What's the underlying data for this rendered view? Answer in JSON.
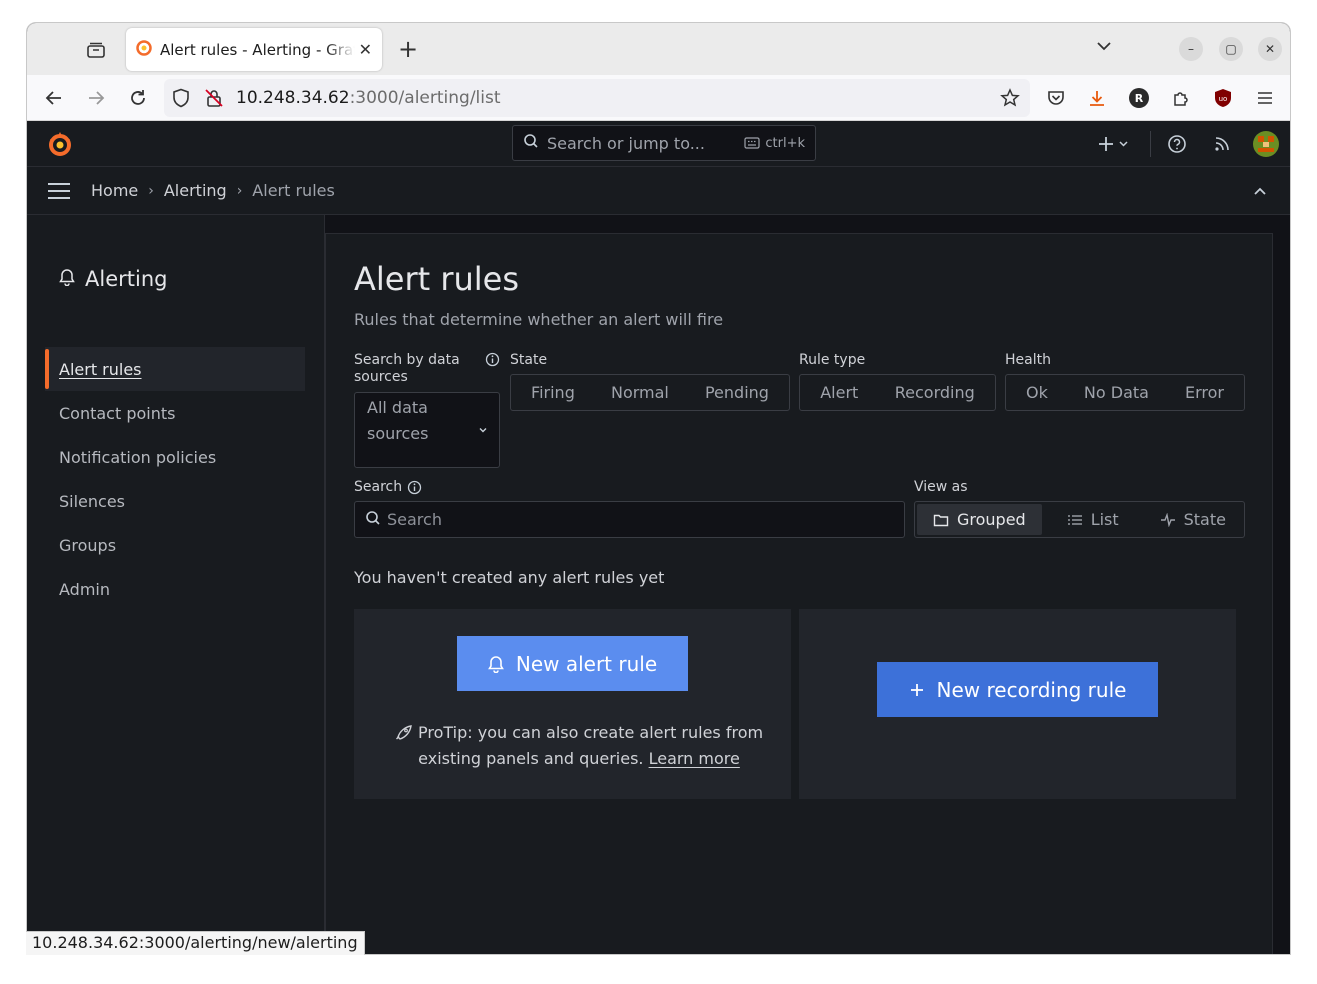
{
  "browser": {
    "tab_title": "Alert rules - Alerting - Grafana",
    "url_host": "10.248.34.62",
    "url_path": ":3000/alerting/list",
    "status_url": "10.248.34.62:3000/alerting/new/alerting",
    "profile_initial": "R"
  },
  "topbar": {
    "search_placeholder": "Search or jump to...",
    "shortcut": "ctrl+k"
  },
  "breadcrumb": {
    "home": "Home",
    "alerting": "Alerting",
    "current": "Alert rules"
  },
  "sidebar": {
    "heading": "Alerting",
    "items": [
      {
        "label": "Alert rules"
      },
      {
        "label": "Contact points"
      },
      {
        "label": "Notification policies"
      },
      {
        "label": "Silences"
      },
      {
        "label": "Groups"
      },
      {
        "label": "Admin"
      }
    ]
  },
  "page": {
    "title": "Alert rules",
    "subtitle": "Rules that determine whether an alert will fire"
  },
  "filters": {
    "datasource_label": "Search by data sources",
    "datasource_value": "All data sources",
    "state_label": "State",
    "state_options": [
      "Firing",
      "Normal",
      "Pending"
    ],
    "ruletype_label": "Rule type",
    "ruletype_options": [
      "Alert",
      "Recording"
    ],
    "health_label": "Health",
    "health_options": [
      "Ok",
      "No Data",
      "Error"
    ],
    "search_label": "Search",
    "search_placeholder": "Search",
    "viewas_label": "View as",
    "viewas_options": [
      "Grouped",
      "List",
      "State"
    ],
    "viewas_selected": "Grouped"
  },
  "empty": {
    "message": "You haven't created any alert rules yet",
    "new_alert_button": "New alert rule",
    "protip_text": "ProTip: you can also create alert rules from existing panels and queries.",
    "learn_more": "Learn more",
    "new_recording_button": "New recording rule"
  },
  "colors": {
    "accent_orange": "#f46c2b",
    "primary_button": "#3d71d9",
    "primary_button_hover": "#5b8def"
  }
}
